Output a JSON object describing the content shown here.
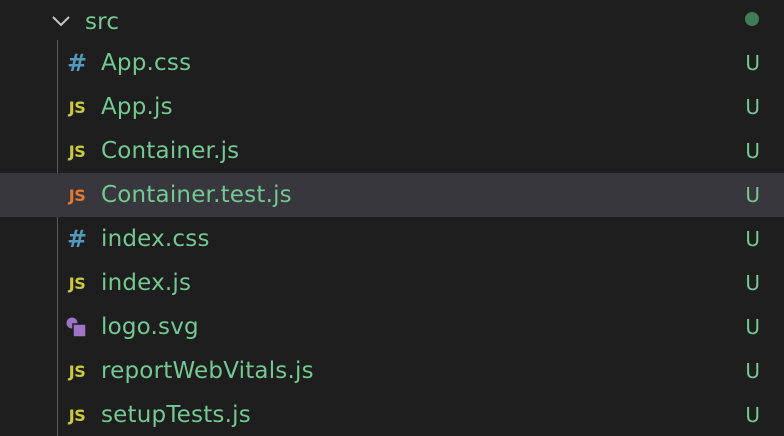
{
  "folder": {
    "name": "src",
    "icon": "chevron-down-icon",
    "status_color": "#3e7e52"
  },
  "files": [
    {
      "name": "App.css",
      "icon": "css-file-icon",
      "glyph": "#",
      "icon_color": "#519aba",
      "status": "U"
    },
    {
      "name": "App.js",
      "icon": "js-file-icon",
      "glyph": "JS",
      "icon_color": "#cbcb41",
      "status": "U"
    },
    {
      "name": "Container.js",
      "icon": "js-file-icon",
      "glyph": "JS",
      "icon_color": "#cbcb41",
      "status": "U"
    },
    {
      "name": "Container.test.js",
      "icon": "js-test-file-icon",
      "glyph": "JS",
      "icon_color": "#e37933",
      "status": "U",
      "selected": true
    },
    {
      "name": "index.css",
      "icon": "css-file-icon",
      "glyph": "#",
      "icon_color": "#519aba",
      "status": "U"
    },
    {
      "name": "index.js",
      "icon": "js-file-icon",
      "glyph": "JS",
      "icon_color": "#cbcb41",
      "status": "U"
    },
    {
      "name": "logo.svg",
      "icon": "svg-file-icon",
      "glyph": "",
      "icon_color": "#a074c4",
      "status": "U"
    },
    {
      "name": "reportWebVitals.js",
      "icon": "js-file-icon",
      "glyph": "JS",
      "icon_color": "#cbcb41",
      "status": "U"
    },
    {
      "name": "setupTests.js",
      "icon": "js-file-icon",
      "glyph": "JS",
      "icon_color": "#cbcb41",
      "status": "U"
    }
  ],
  "colors": {
    "background": "#1e1e1e",
    "selected_background": "#37373d",
    "untracked_text": "#73c991",
    "tree_guide": "#585858"
  }
}
